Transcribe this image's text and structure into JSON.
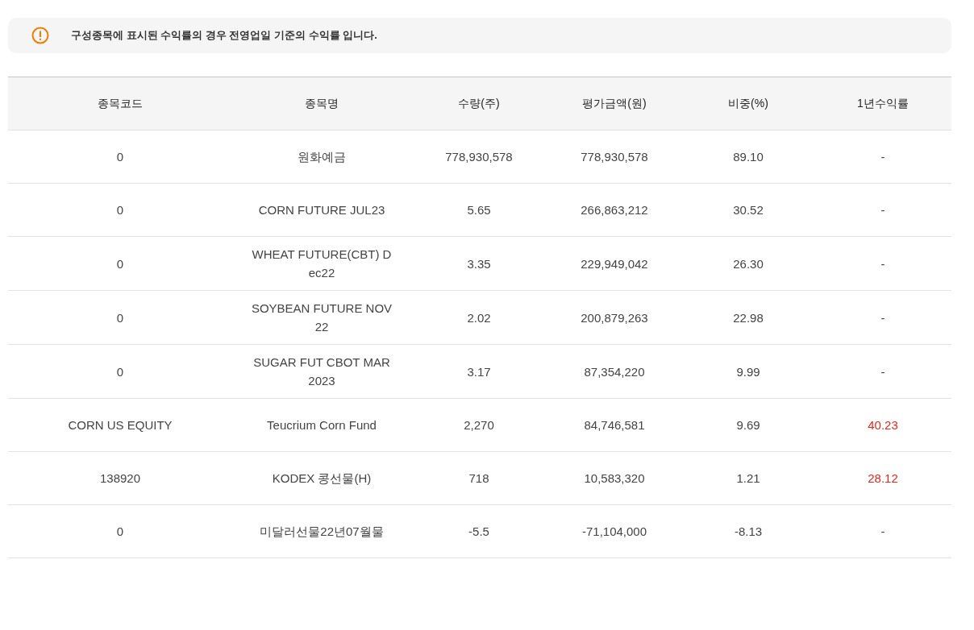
{
  "notice": {
    "text": "구성종목에 표시된 수익률의 경우 전영업일 기준의 수익률 입니다."
  },
  "table": {
    "columns": [
      "종목코드",
      "종목명",
      "수량(주)",
      "평가금액(원)",
      "비중(%)",
      "1년수익률"
    ],
    "rows": [
      {
        "code": "0",
        "name": "원화예금",
        "quantity": "778,930,578",
        "value": "778,930,578",
        "weight": "89.10",
        "return": "-",
        "positive": false
      },
      {
        "code": "0",
        "name": "CORN FUTURE JUL23",
        "quantity": "5.65",
        "value": "266,863,212",
        "weight": "30.52",
        "return": "-",
        "positive": false
      },
      {
        "code": "0",
        "name": "WHEAT FUTURE(CBT) Dec22",
        "quantity": "3.35",
        "value": "229,949,042",
        "weight": "26.30",
        "return": "-",
        "positive": false
      },
      {
        "code": "0",
        "name": "SOYBEAN FUTURE NOV 22",
        "quantity": "2.02",
        "value": "200,879,263",
        "weight": "22.98",
        "return": "-",
        "positive": false
      },
      {
        "code": "0",
        "name": "SUGAR FUT CBOT MAR 2023",
        "quantity": "3.17",
        "value": "87,354,220",
        "weight": "9.99",
        "return": "-",
        "positive": false
      },
      {
        "code": "CORN US EQUITY",
        "name": "Teucrium Corn Fund",
        "quantity": "2,270",
        "value": "84,746,581",
        "weight": "9.69",
        "return": "40.23",
        "positive": true
      },
      {
        "code": "138920",
        "name": "KODEX 콩선물(H)",
        "quantity": "718",
        "value": "10,583,320",
        "weight": "1.21",
        "return": "28.12",
        "positive": true
      },
      {
        "code": "0",
        "name": "미달러선물22년07월물",
        "quantity": "-5.5",
        "value": "-71,104,000",
        "weight": "-8.13",
        "return": "-",
        "positive": false
      }
    ]
  }
}
